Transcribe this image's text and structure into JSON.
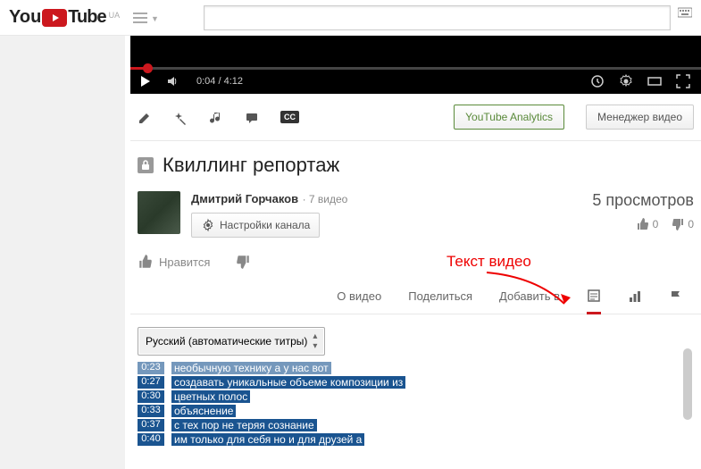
{
  "header": {
    "logo_text": "Tube",
    "logo_prefix": "You",
    "region": "UA",
    "search_placeholder": ""
  },
  "player": {
    "current_time": "0:04",
    "duration": "4:12"
  },
  "action_buttons": {
    "analytics": "YouTube Analytics",
    "manager": "Менеджер видео"
  },
  "video": {
    "title": "Квиллинг репортаж"
  },
  "channel": {
    "name": "Дмитрий Горчаков",
    "video_count": "7 видео",
    "settings_label": "Настройки канала"
  },
  "stats": {
    "views": "5 просмотров",
    "likes": "0",
    "dislikes": "0"
  },
  "actions": {
    "like_label": "Нравится"
  },
  "tabs": {
    "about": "О видео",
    "share": "Поделиться",
    "add_to": "Добавить в"
  },
  "transcript": {
    "language_label": "Русский (автоматические титры)",
    "lines": [
      {
        "time": "0:23",
        "text": "необычную технику а у нас вот"
      },
      {
        "time": "0:27",
        "text": "создавать уникальные объеме композиции из"
      },
      {
        "time": "0:30",
        "text": "цветных полос"
      },
      {
        "time": "0:33",
        "text": "объяснение"
      },
      {
        "time": "0:37",
        "text": "с тех пор не теряя сознание"
      },
      {
        "time": "0:40",
        "text": "им только для себя но и для друзей а"
      }
    ]
  },
  "annotation": {
    "label": "Текст видео"
  }
}
